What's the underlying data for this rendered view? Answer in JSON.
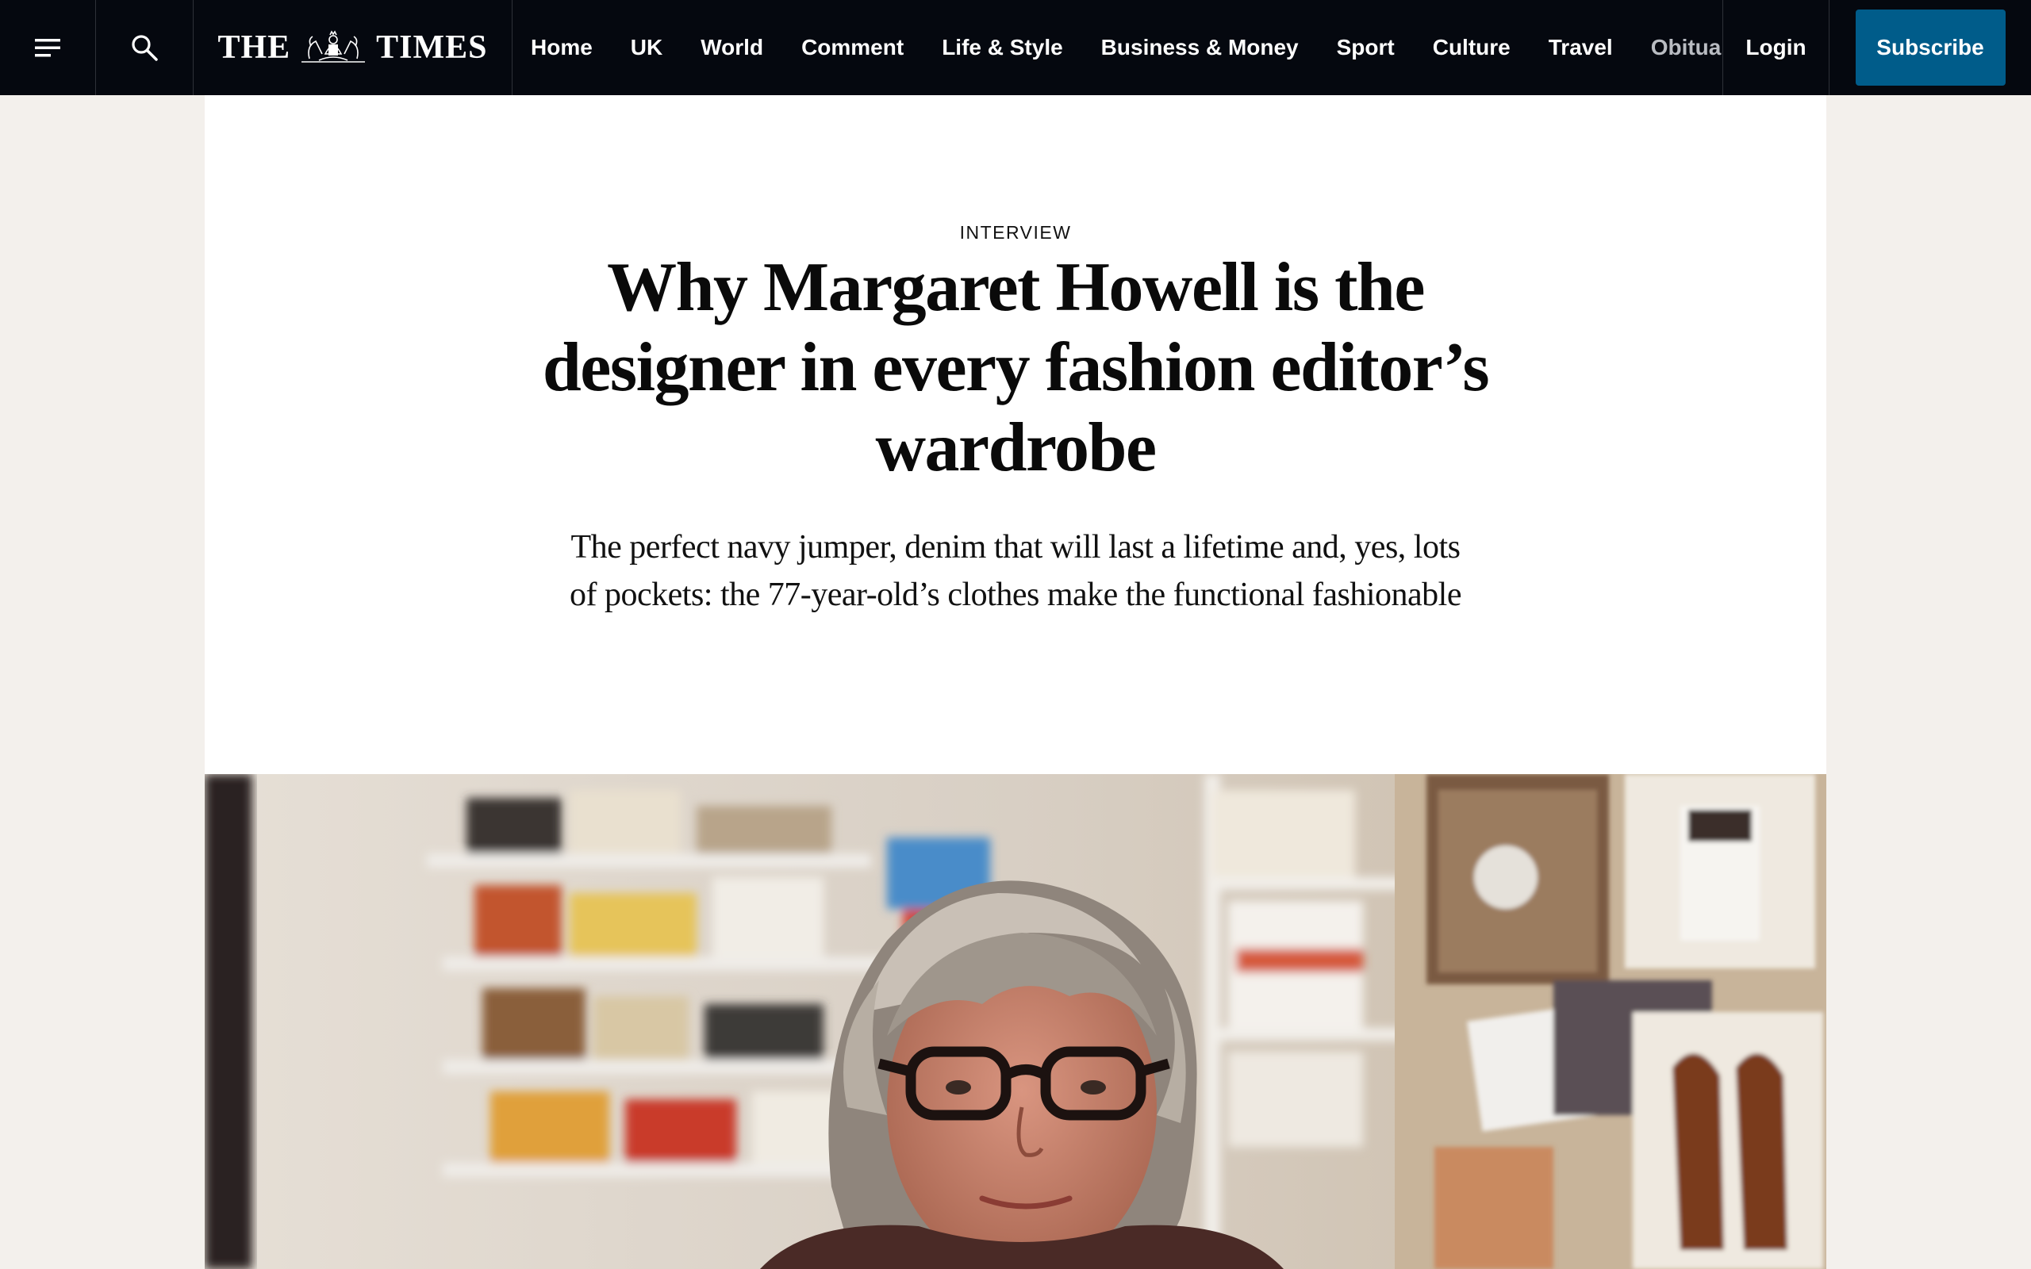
{
  "topbar": {
    "menu_icon": "hamburger-menu-icon",
    "search_icon": "search-icon",
    "logo_left": "THE",
    "logo_right": "TIMES",
    "nav": [
      {
        "label": "Home"
      },
      {
        "label": "UK"
      },
      {
        "label": "World"
      },
      {
        "label": "Comment"
      },
      {
        "label": "Life & Style"
      },
      {
        "label": "Business & Money"
      },
      {
        "label": "Sport"
      },
      {
        "label": "Culture"
      },
      {
        "label": "Travel"
      },
      {
        "label": "Obituaries"
      }
    ],
    "login": "Login",
    "subscribe": "Subscribe",
    "colors": {
      "bar": "#05080f",
      "subscribe": "#005c8a"
    }
  },
  "article": {
    "label": "INTERVIEW",
    "headline": "Why Margaret Howell is the designer in every fashion editor’s wardrobe",
    "standfirst": "The perfect navy jumper, denim that will last a lifetime and, yes, lots of pockets: the 77-year-old’s clothes make the functional fashionable"
  }
}
